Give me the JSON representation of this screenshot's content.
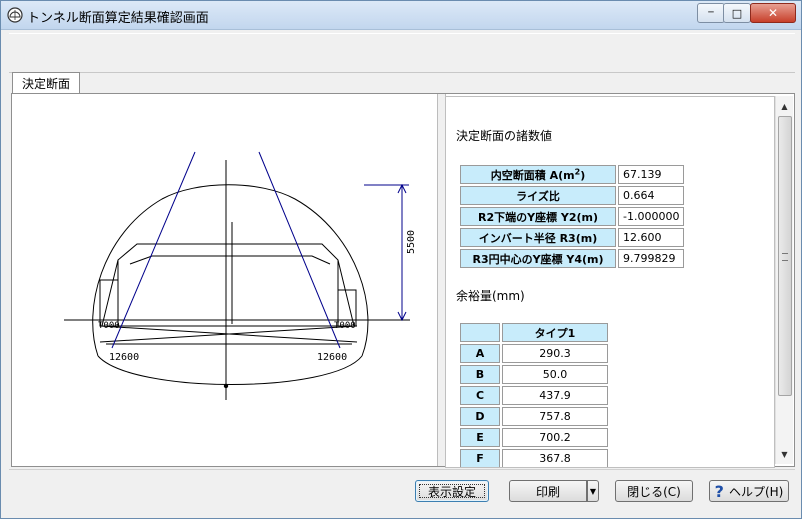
{
  "window": {
    "title": "トンネル断面算定結果確認画面",
    "minimize_glyph": "─",
    "maximize_glyph": "□",
    "close_glyph": "✕"
  },
  "tabs": [
    {
      "label": "決定断面",
      "selected": true
    }
  ],
  "drawing": {
    "dimension_label": "5500",
    "left_label": "12600",
    "right_label": "12600",
    "left_box_label": "T000",
    "right_box_label": "T000"
  },
  "properties": {
    "title": "決定断面の諸数値",
    "rows": [
      {
        "label": "内空断面積 A(m²)",
        "value": "67.139"
      },
      {
        "label": "ライズ比",
        "value": "0.664"
      },
      {
        "label": "R2下端のY座標 Y2(m)",
        "value": "-1.000000"
      },
      {
        "label": "インバート半径 R3(m)",
        "value": "12.600"
      },
      {
        "label": "R3円中心のY座標 Y4(m)",
        "value": "9.799829"
      }
    ]
  },
  "margins": {
    "title": "余裕量(mm)",
    "column_header": "タイプ1",
    "rows": [
      {
        "label": "A",
        "value": "290.3"
      },
      {
        "label": "B",
        "value": "50.0"
      },
      {
        "label": "C",
        "value": "437.9"
      },
      {
        "label": "D",
        "value": "757.8"
      },
      {
        "label": "E",
        "value": "700.2"
      },
      {
        "label": "F",
        "value": "367.8"
      }
    ]
  },
  "buttons": {
    "display_settings": "表示設定",
    "print": "印刷",
    "close": "閉じる(C)",
    "help": "ヘルプ(H)",
    "help_icon": "question-mark"
  }
}
